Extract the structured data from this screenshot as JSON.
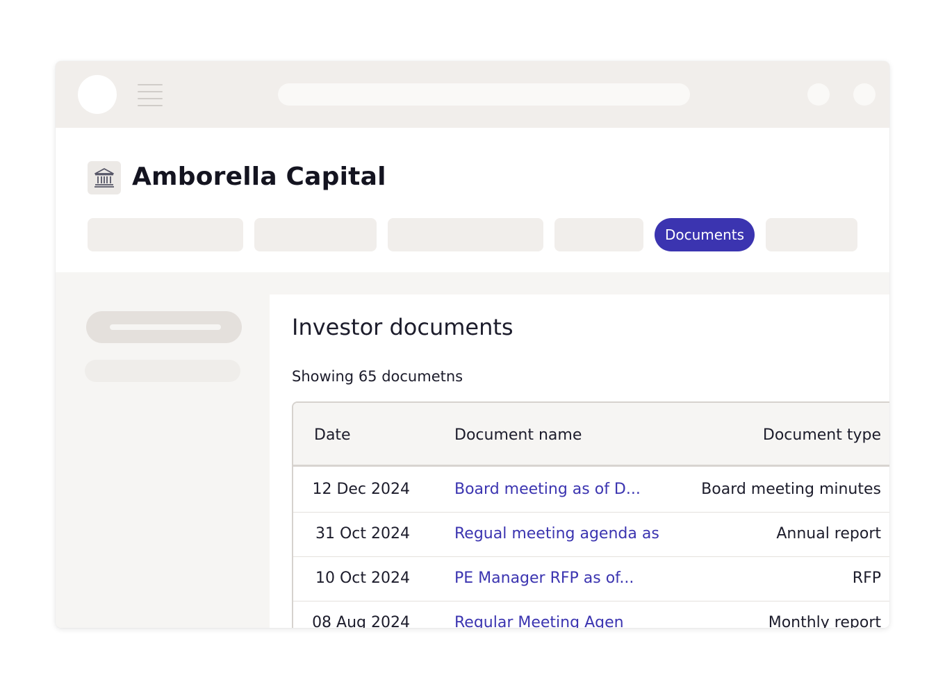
{
  "header": {
    "org_name": "Amborella Capital",
    "org_icon": "bank-building-icon"
  },
  "tabs": [
    {
      "label": ""
    },
    {
      "label": ""
    },
    {
      "label": ""
    },
    {
      "label": ""
    },
    {
      "label": "Documents",
      "active": true
    },
    {
      "label": ""
    }
  ],
  "main": {
    "title": "Investor documents",
    "count_text": "Showing 65 documetns",
    "columns": {
      "date": "Date",
      "name": "Document name",
      "type": "Document type"
    },
    "rows": [
      {
        "date": "12 Dec 2024",
        "name": "Board meeting as of D...",
        "type": "Board meeting minutes"
      },
      {
        "date": "31 Oct 2024",
        "name": "Regual meeting agenda as",
        "type": "Annual report"
      },
      {
        "date": "10 Oct 2024",
        "name": "PE Manager RFP as of...",
        "type": "RFP"
      },
      {
        "date": "08 Aug 2024",
        "name": "Regular Meeting Agen",
        "type": "Monthly report"
      }
    ]
  },
  "colors": {
    "accent": "#3b34b0",
    "chrome": "#f1eeeb",
    "surface": "#f6f5f3"
  }
}
